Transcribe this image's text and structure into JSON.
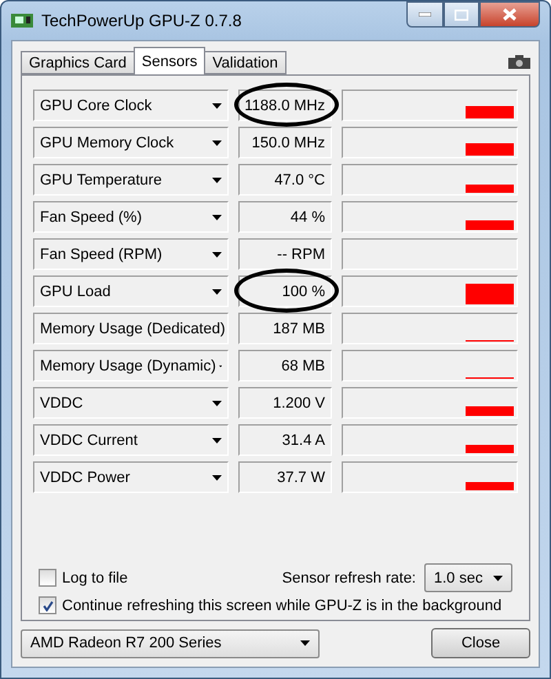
{
  "window": {
    "title": "TechPowerUp GPU-Z 0.7.8"
  },
  "tabs": [
    {
      "label": "Graphics Card",
      "selected": false
    },
    {
      "label": "Sensors",
      "selected": true
    },
    {
      "label": "Validation",
      "selected": false
    }
  ],
  "sensors": [
    {
      "name": "GPU Core Clock",
      "value": "1188.0 MHz",
      "circled": true
    },
    {
      "name": "GPU Memory Clock",
      "value": "150.0 MHz",
      "circled": false
    },
    {
      "name": "GPU Temperature",
      "value": "47.0 °C",
      "circled": false
    },
    {
      "name": "Fan Speed (%)",
      "value": "44 %",
      "circled": false
    },
    {
      "name": "Fan Speed (RPM)",
      "value": "-- RPM",
      "circled": false
    },
    {
      "name": "GPU Load",
      "value": "100 %",
      "circled": true
    },
    {
      "name": "Memory Usage (Dedicated)",
      "value": "187 MB",
      "circled": false
    },
    {
      "name": "Memory Usage (Dynamic)",
      "value": "68 MB",
      "circled": false
    },
    {
      "name": "VDDC",
      "value": "1.200 V",
      "circled": false
    },
    {
      "name": "VDDC Current",
      "value": "31.4 A",
      "circled": false
    },
    {
      "name": "VDDC Power",
      "value": "37.7 W",
      "circled": false
    }
  ],
  "log_to_file": {
    "label": "Log to file",
    "checked": false
  },
  "refresh_rate": {
    "label": "Sensor refresh rate:",
    "value": "1.0 sec"
  },
  "continue_refreshing": {
    "label": "Continue refreshing this screen while GPU-Z is in the background",
    "checked": true
  },
  "device": {
    "value": "AMD Radeon R7 200 Series"
  },
  "buttons": [
    {
      "label": "Close"
    }
  ]
}
